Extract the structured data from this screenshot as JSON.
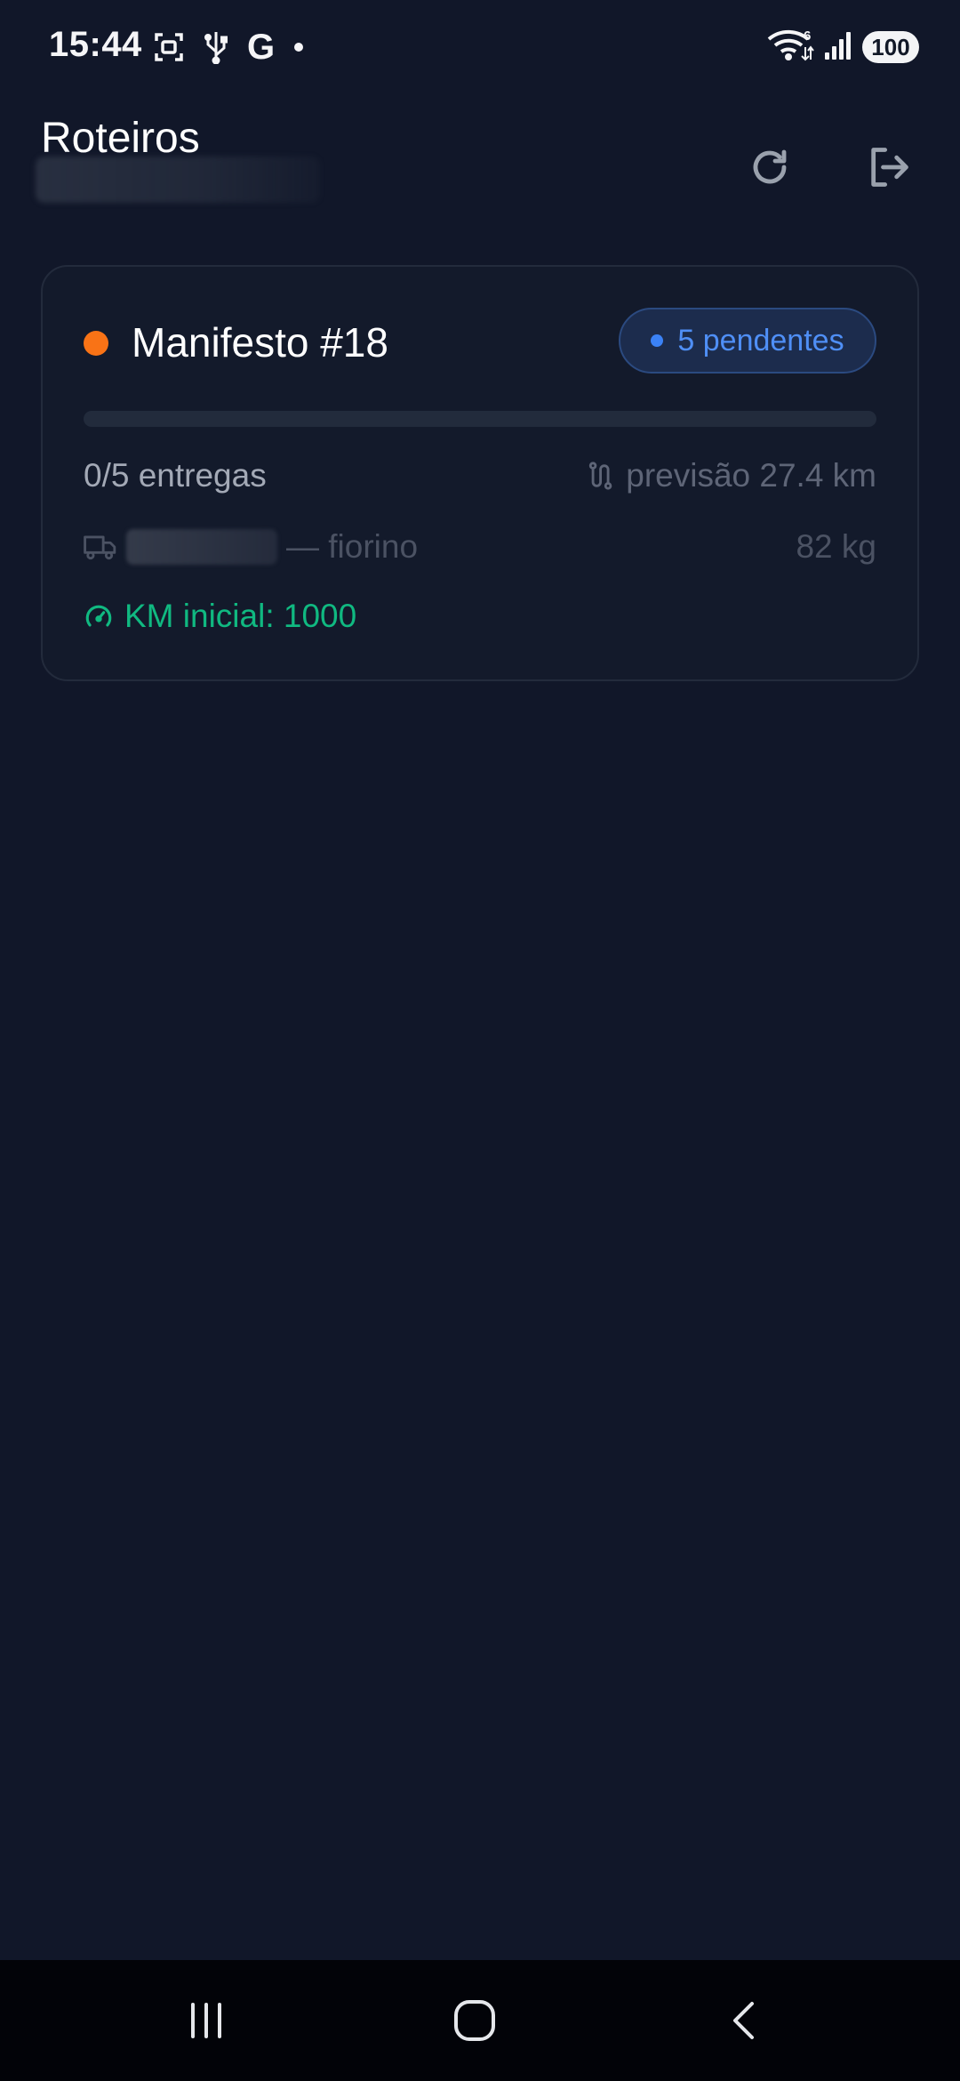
{
  "status_bar": {
    "time": "15:44",
    "left_icons": [
      "screenshot-icon",
      "usb-icon",
      "google-icon",
      "notification-dot"
    ],
    "google_letter": "G",
    "right_icons": [
      "wifi-icon",
      "signal-icon"
    ],
    "wifi_badge": "6",
    "battery": "100"
  },
  "header": {
    "title": "Roteiros",
    "refresh_icon": "refresh-icon",
    "logout_icon": "logout-icon"
  },
  "manifest": {
    "title": "Manifesto #18",
    "status_color": "#f97316",
    "badge_label": "5 pendentes",
    "badge_color": "#3b82f6",
    "progress_fraction": 0,
    "deliveries": "0/5 entregas",
    "forecast": "previsão 27.4 km",
    "vehicle_model": "— fiorino",
    "weight": "82 kg",
    "km_initial": "KM inicial: 1000",
    "km_color": "#10b981"
  },
  "nav": {
    "recent": "recent-apps-icon",
    "home": "home-icon",
    "back": "back-icon"
  }
}
